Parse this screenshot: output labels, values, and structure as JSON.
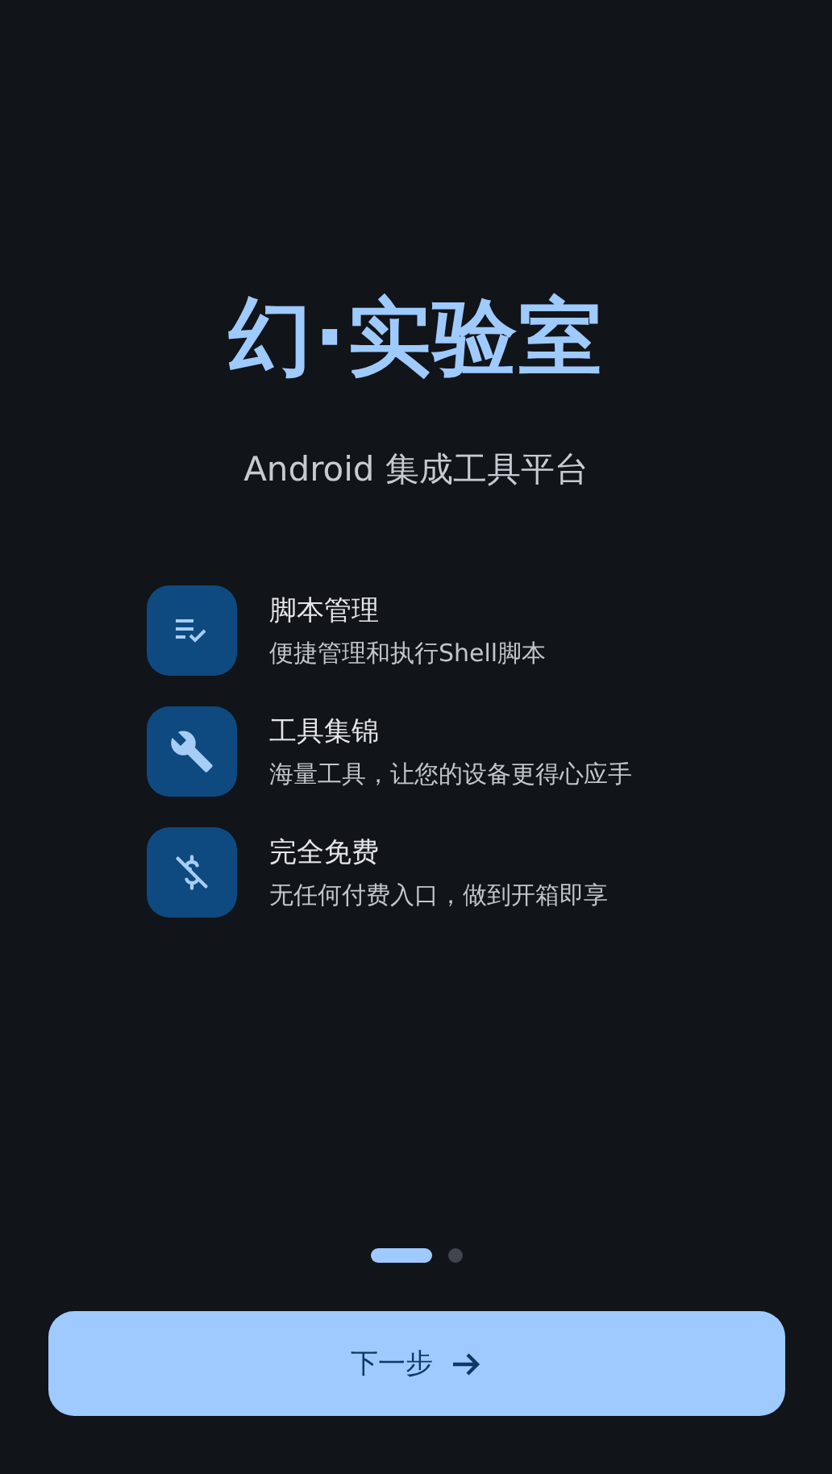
{
  "app": {
    "title": "幻·实验室",
    "subtitle": "Android 集成工具平台"
  },
  "features": [
    {
      "kind": "script",
      "title": "脚本管理",
      "description": "便捷管理和执行Shell脚本"
    },
    {
      "kind": "tools",
      "title": "工具集锦",
      "description": "海量工具，让您的设备更得心应手"
    },
    {
      "kind": "free",
      "title": "完全免费",
      "description": "无任何付费入口，做到开箱即享"
    }
  ],
  "page_indicator": [
    {
      "selected": true
    },
    {
      "selected": false
    }
  ],
  "next_button": {
    "label": "下一步"
  }
}
